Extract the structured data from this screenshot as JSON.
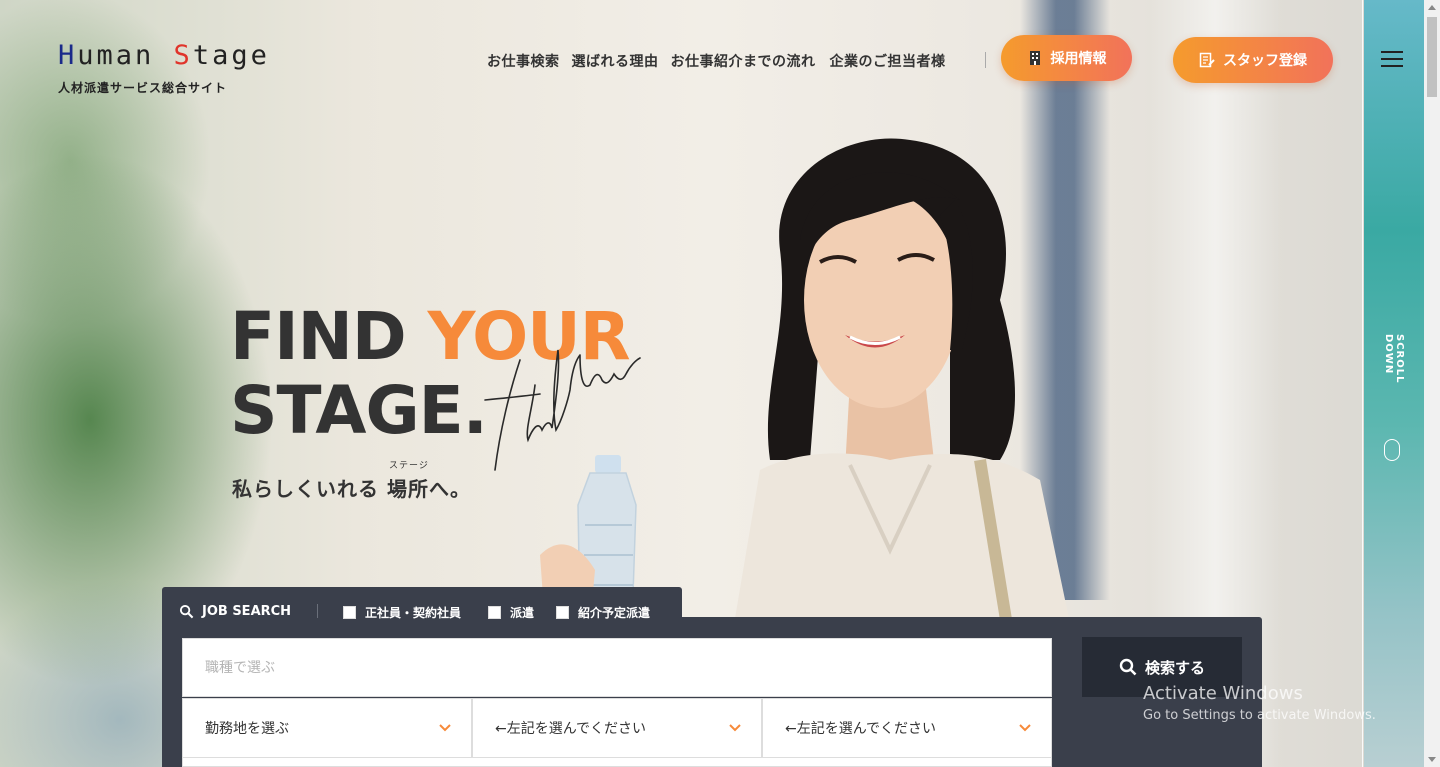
{
  "header": {
    "logo_first": "H",
    "logo_mid": "uman ",
    "logo_s": "S",
    "logo_end": "tage",
    "logo_subtitle": "人材派遣サービス総合サイト",
    "nav": [
      "お仕事検索",
      "選ばれる理由",
      "お仕事紹介までの流れ",
      "企業のご担当者様"
    ],
    "recruit_button": "採用情報",
    "staff_button": "スタッフ登録",
    "scroll_label": "SCROLL DOWN"
  },
  "hero": {
    "line1_a": "FIND ",
    "line1_b": "YOUR",
    "line2": "STAGE.",
    "script_text": "find New",
    "tagline": "私らしくいれる 場所へ。",
    "ruby": "ステージ"
  },
  "job_search": {
    "label": "JOB SEARCH",
    "checkboxes": [
      "正社員・契約社員",
      "派遣",
      "紹介予定派遣"
    ],
    "job_placeholder": "職種で選ぶ",
    "selects": [
      "勤務地を選ぶ",
      "←左記を選んでください",
      "←左記を選んでください"
    ],
    "search_button": "検索する"
  },
  "watermark": {
    "title": "Activate Windows",
    "subtitle": "Go to Settings to activate Windows."
  },
  "colors": {
    "accent": "#f68a3a",
    "button_gradient_start": "#f59b2d",
    "button_gradient_end": "#f2725a",
    "panel": "#3a3f4b",
    "logo_h": "#1a2a8a",
    "logo_s": "#e0342b"
  }
}
